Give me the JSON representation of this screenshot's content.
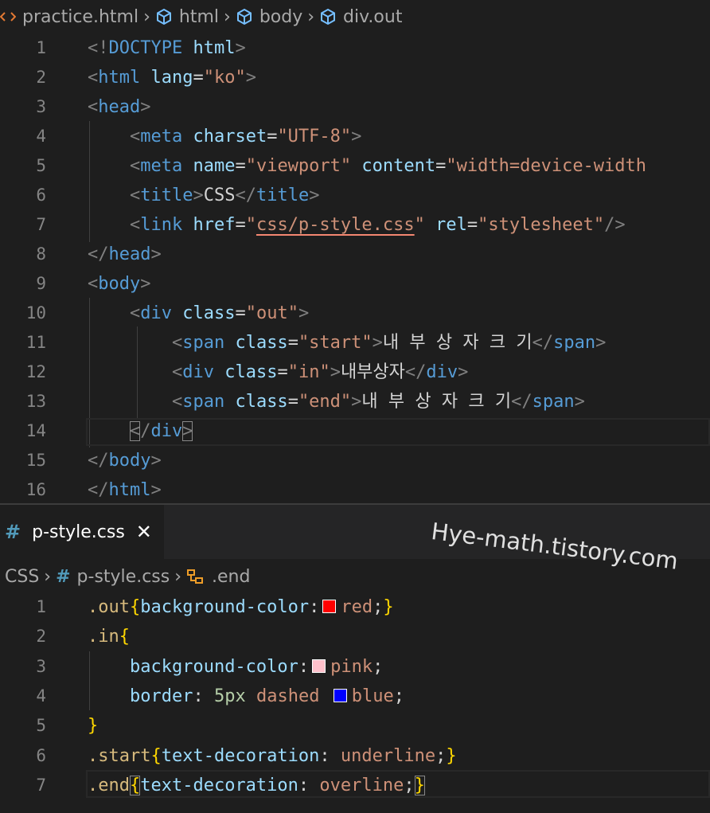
{
  "html_editor": {
    "breadcrumb": [
      "practice.html",
      "html",
      "body",
      "div.out"
    ],
    "lines": [
      {
        "n": "1",
        "tokens": [
          [
            "p",
            "<!"
          ],
          [
            "t",
            "DOCTYPE"
          ],
          [
            "x",
            " "
          ],
          [
            "a",
            "html"
          ],
          [
            "p",
            ">"
          ]
        ]
      },
      {
        "n": "2",
        "tokens": [
          [
            "p",
            "<"
          ],
          [
            "t",
            "html"
          ],
          [
            "x",
            " "
          ],
          [
            "a",
            "lang"
          ],
          [
            "x",
            "="
          ],
          [
            "s",
            "\"ko\""
          ],
          [
            "p",
            ">"
          ]
        ]
      },
      {
        "n": "3",
        "tokens": [
          [
            "p",
            "<"
          ],
          [
            "t",
            "head"
          ],
          [
            "p",
            ">"
          ]
        ]
      },
      {
        "n": "4",
        "tokens": [
          [
            "x",
            "    "
          ],
          [
            "p",
            "<"
          ],
          [
            "t",
            "meta"
          ],
          [
            "x",
            " "
          ],
          [
            "a",
            "charset"
          ],
          [
            "x",
            "="
          ],
          [
            "s",
            "\"UTF-8\""
          ],
          [
            "p",
            ">"
          ]
        ]
      },
      {
        "n": "5",
        "tokens": [
          [
            "x",
            "    "
          ],
          [
            "p",
            "<"
          ],
          [
            "t",
            "meta"
          ],
          [
            "x",
            " "
          ],
          [
            "a",
            "name"
          ],
          [
            "x",
            "="
          ],
          [
            "s",
            "\"viewport\""
          ],
          [
            "x",
            " "
          ],
          [
            "a",
            "content"
          ],
          [
            "x",
            "="
          ],
          [
            "s",
            "\"width=device-width"
          ]
        ]
      },
      {
        "n": "6",
        "tokens": [
          [
            "x",
            "    "
          ],
          [
            "p",
            "<"
          ],
          [
            "t",
            "title"
          ],
          [
            "p",
            ">"
          ],
          [
            "x",
            "CSS"
          ],
          [
            "p",
            "</"
          ],
          [
            "t",
            "title"
          ],
          [
            "p",
            ">"
          ]
        ]
      },
      {
        "n": "7",
        "tokens": [
          [
            "x",
            "    "
          ],
          [
            "p",
            "<"
          ],
          [
            "t",
            "link"
          ],
          [
            "x",
            " "
          ],
          [
            "a",
            "href"
          ],
          [
            "x",
            "="
          ],
          [
            "s",
            "\""
          ],
          [
            "su",
            "css/p-style.css"
          ],
          [
            "s",
            "\""
          ],
          [
            "x",
            " "
          ],
          [
            "a",
            "rel"
          ],
          [
            "x",
            "="
          ],
          [
            "s",
            "\"stylesheet\""
          ],
          [
            "p",
            "/>"
          ]
        ]
      },
      {
        "n": "8",
        "tokens": [
          [
            "p",
            "</"
          ],
          [
            "t",
            "head"
          ],
          [
            "p",
            ">"
          ]
        ]
      },
      {
        "n": "9",
        "tokens": [
          [
            "p",
            "<"
          ],
          [
            "t",
            "body"
          ],
          [
            "p",
            ">"
          ]
        ]
      },
      {
        "n": "10",
        "tokens": [
          [
            "x",
            "    "
          ],
          [
            "p",
            "<"
          ],
          [
            "t",
            "div"
          ],
          [
            "x",
            " "
          ],
          [
            "a",
            "class"
          ],
          [
            "x",
            "="
          ],
          [
            "s",
            "\"out\""
          ],
          [
            "p",
            ">"
          ]
        ]
      },
      {
        "n": "11",
        "tokens": [
          [
            "x",
            "        "
          ],
          [
            "p",
            "<"
          ],
          [
            "t",
            "span"
          ],
          [
            "x",
            " "
          ],
          [
            "a",
            "class"
          ],
          [
            "x",
            "="
          ],
          [
            "s",
            "\"start\""
          ],
          [
            "p",
            ">"
          ],
          [
            "x",
            "내 부 상 자 크 기"
          ],
          [
            "p",
            "</"
          ],
          [
            "t",
            "span"
          ],
          [
            "p",
            ">"
          ]
        ]
      },
      {
        "n": "12",
        "tokens": [
          [
            "x",
            "        "
          ],
          [
            "p",
            "<"
          ],
          [
            "t",
            "div"
          ],
          [
            "x",
            " "
          ],
          [
            "a",
            "class"
          ],
          [
            "x",
            "="
          ],
          [
            "s",
            "\"in\""
          ],
          [
            "p",
            ">"
          ],
          [
            "x",
            "내부상자"
          ],
          [
            "p",
            "</"
          ],
          [
            "t",
            "div"
          ],
          [
            "p",
            ">"
          ]
        ]
      },
      {
        "n": "13",
        "tokens": [
          [
            "x",
            "        "
          ],
          [
            "p",
            "<"
          ],
          [
            "t",
            "span"
          ],
          [
            "x",
            " "
          ],
          [
            "a",
            "class"
          ],
          [
            "x",
            "="
          ],
          [
            "s",
            "\"end\""
          ],
          [
            "p",
            ">"
          ],
          [
            "x",
            "내 부 상 자 크 기"
          ],
          [
            "p",
            "</"
          ],
          [
            "t",
            "span"
          ],
          [
            "p",
            ">"
          ]
        ]
      },
      {
        "n": "14",
        "tokens": [
          [
            "x",
            "    "
          ],
          [
            "pb",
            "<"
          ],
          [
            "p",
            "/"
          ],
          [
            "t",
            "div"
          ],
          [
            "pb",
            ">"
          ]
        ]
      },
      {
        "n": "15",
        "tokens": [
          [
            "p",
            "</"
          ],
          [
            "t",
            "body"
          ],
          [
            "p",
            ">"
          ]
        ]
      },
      {
        "n": "16",
        "tokens": [
          [
            "p",
            "</"
          ],
          [
            "t",
            "html"
          ],
          [
            "p",
            ">"
          ]
        ]
      }
    ]
  },
  "css_editor": {
    "tab_label": "p-style.css",
    "tab_close": "✕",
    "watermark": "Hye-math.tistory.com",
    "breadcrumb": [
      "CSS",
      "p-style.css",
      ".end"
    ],
    "lines": [
      {
        "n": "1",
        "tokens": [
          [
            "sel",
            ".out"
          ],
          [
            "b1",
            "{"
          ],
          [
            "prop",
            "background-color"
          ],
          [
            "x",
            ":"
          ],
          [
            "sw_red",
            ""
          ],
          [
            "val",
            "red"
          ],
          [
            "x",
            ";"
          ],
          [
            "b1",
            "}"
          ]
        ]
      },
      {
        "n": "2",
        "tokens": [
          [
            "sel",
            ".in"
          ],
          [
            "b1",
            "{"
          ]
        ]
      },
      {
        "n": "3",
        "tokens": [
          [
            "x",
            "    "
          ],
          [
            "prop",
            "background-color"
          ],
          [
            "x",
            ":"
          ],
          [
            "sw_pink",
            ""
          ],
          [
            "val",
            "pink"
          ],
          [
            "x",
            ";"
          ]
        ]
      },
      {
        "n": "4",
        "tokens": [
          [
            "x",
            "    "
          ],
          [
            "prop",
            "border"
          ],
          [
            "x",
            ": "
          ],
          [
            "num",
            "5px"
          ],
          [
            "x",
            " "
          ],
          [
            "val",
            "dashed"
          ],
          [
            "x",
            " "
          ],
          [
            "sw_blue",
            ""
          ],
          [
            "val",
            "blue"
          ],
          [
            "x",
            ";"
          ]
        ]
      },
      {
        "n": "5",
        "tokens": [
          [
            "b1",
            "}"
          ]
        ]
      },
      {
        "n": "6",
        "tokens": [
          [
            "sel",
            ".start"
          ],
          [
            "b1",
            "{"
          ],
          [
            "prop",
            "text-decoration"
          ],
          [
            "x",
            ": "
          ],
          [
            "val",
            "underline"
          ],
          [
            "x",
            ";"
          ],
          [
            "b1",
            "}"
          ]
        ]
      },
      {
        "n": "7",
        "tokens": [
          [
            "sel",
            ".end"
          ],
          [
            "b1b",
            "{"
          ],
          [
            "prop",
            "text-decoration"
          ],
          [
            "x",
            ": "
          ],
          [
            "val",
            "overline"
          ],
          [
            "x",
            ";"
          ],
          [
            "b1b",
            "}"
          ]
        ]
      }
    ]
  },
  "colors": {
    "swatch_red": "#ff0000",
    "swatch_pink": "#ffc0cb",
    "swatch_blue": "#0000ff"
  }
}
